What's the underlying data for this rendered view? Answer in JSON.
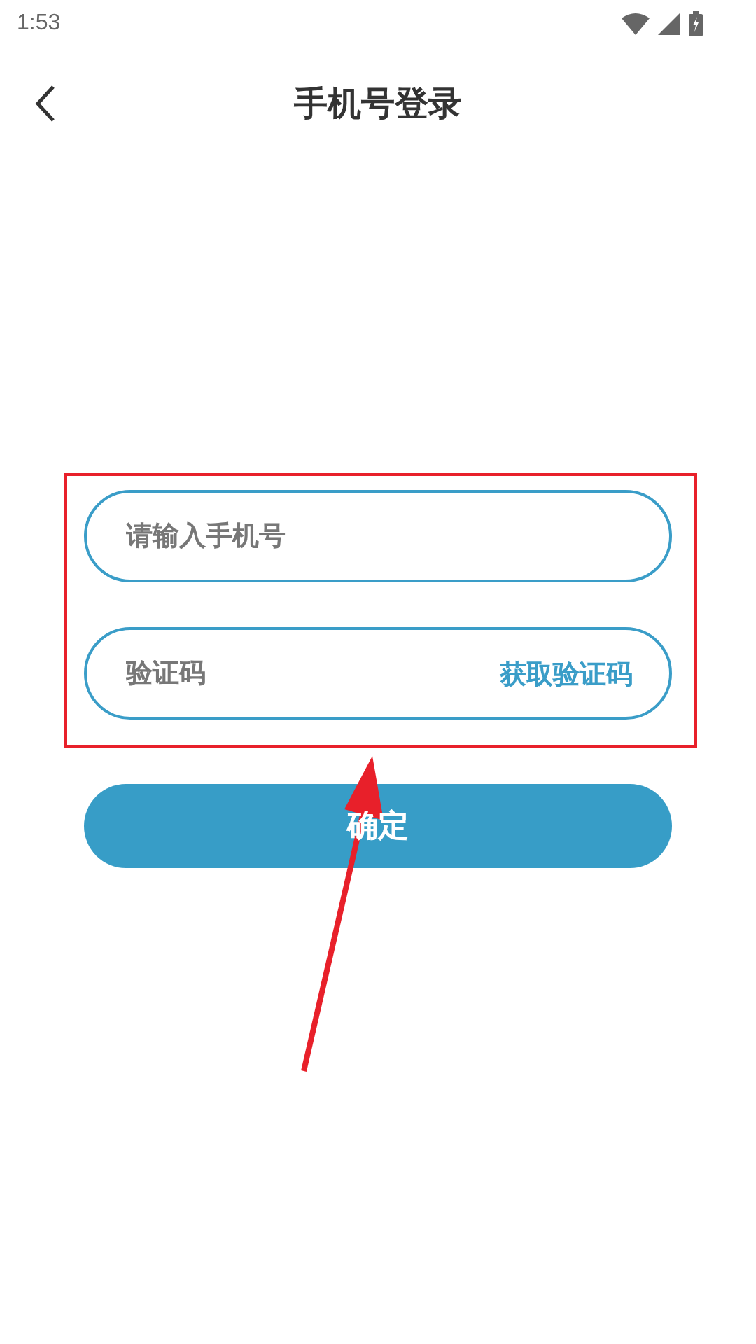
{
  "status_bar": {
    "time": "1:53"
  },
  "header": {
    "title": "手机号登录"
  },
  "form": {
    "phone": {
      "placeholder": "请输入手机号"
    },
    "code": {
      "placeholder": "验证码",
      "action": "获取验证码"
    },
    "submit": "确定"
  },
  "annotation": {
    "kind": "highlight-with-arrow"
  }
}
